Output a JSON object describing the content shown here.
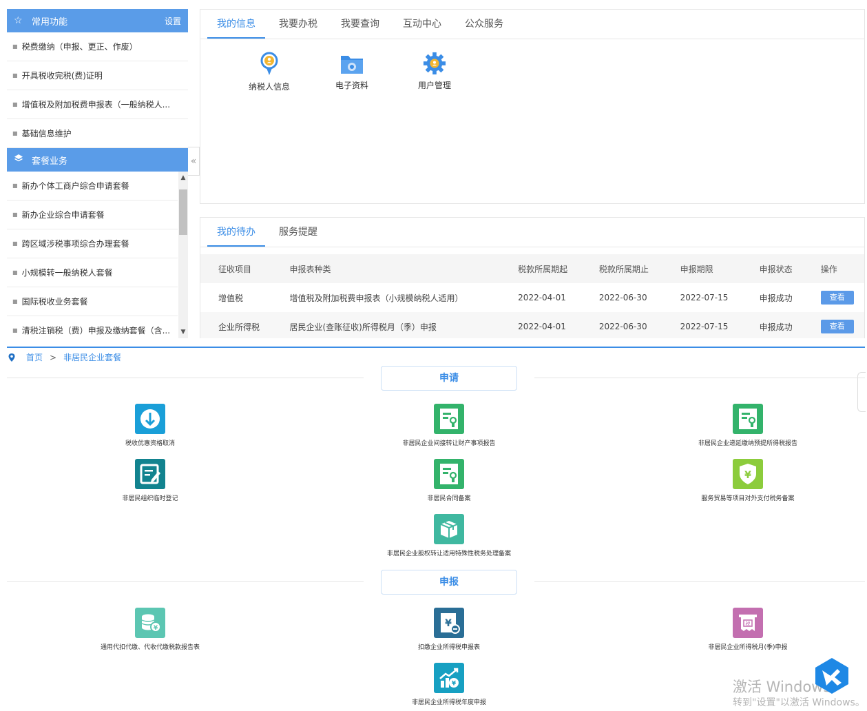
{
  "sidebar": {
    "common": {
      "title": "常用功能",
      "settings_label": "设置"
    },
    "common_items": [
      "税费缴纳（申报、更正、作废）",
      "开具税收完税(费)证明",
      "增值税及附加税费申报表（一般纳税人...",
      "基础信息维护"
    ],
    "packages": {
      "title": "套餐业务"
    },
    "package_items": [
      "新办个体工商户综合申请套餐",
      "新办企业综合申请套餐",
      "跨区域涉税事项综合办理套餐",
      "小规模转一般纳税人套餐",
      "国际税收业务套餐",
      "清税注销税（费）申报及缴纳套餐（含..."
    ],
    "collapse_glyph": "«"
  },
  "info_panel": {
    "tabs": [
      "我的信息",
      "我要办税",
      "我要查询",
      "互动中心",
      "公众服务"
    ],
    "active_tab": 0,
    "quick_icons": [
      {
        "label": "纳税人信息",
        "icon": "taxpayer-info-icon"
      },
      {
        "label": "电子资料",
        "icon": "e-documents-icon"
      },
      {
        "label": "用户管理",
        "icon": "user-management-icon"
      }
    ]
  },
  "todo_panel": {
    "tabs": [
      "我的待办",
      "服务提醒"
    ],
    "active_tab": 0,
    "columns": [
      "征收项目",
      "申报表种类",
      "税款所属期起",
      "税款所属期止",
      "申报期限",
      "申报状态",
      "操作"
    ],
    "rows": [
      [
        "增值税",
        "增值税及附加税费申报表（小规模纳税人适用）",
        "2022-04-01",
        "2022-06-30",
        "2022-07-15",
        "申报成功",
        "查看"
      ],
      [
        "企业所得税",
        "居民企业(查账征收)所得税月（季）申报",
        "2022-04-01",
        "2022-06-30",
        "2022-07-15",
        "申报成功",
        "查看"
      ]
    ]
  },
  "package_page": {
    "breadcrumb": {
      "home": "首页",
      "separator": ">",
      "current": "非居民企业套餐"
    },
    "sections": [
      {
        "title": "申请",
        "services": [
          {
            "label": "税收优惠资格取消",
            "icon": "download-icon",
            "color": "#1a9fd8"
          },
          {
            "label": "非居民企业间接转让财产事项报告",
            "icon": "certificate-icon",
            "color": "#33b36b"
          },
          {
            "label": "非居民企业递延缴纳预提所得税报告",
            "icon": "certificate-icon",
            "color": "#33b36b"
          },
          {
            "label": "非居民组织临时登记",
            "icon": "edit-form-icon",
            "color": "#12838f"
          },
          {
            "label": "非居民合同备案",
            "icon": "certificate-icon",
            "color": "#33b36b"
          },
          {
            "label": "服务贸易等项目对外支付税务备案",
            "icon": "yuan-shield-icon",
            "color": "#8ccc3c"
          },
          {
            "label": "非居民企业股权转让适用特殊性税务处理备案",
            "icon": "box-icon",
            "color": "#3fb8a0"
          }
        ]
      },
      {
        "title": "申报",
        "services": [
          {
            "label": "通用代扣代缴、代收代缴税款报告表",
            "icon": "coins-icon",
            "color": "#5cc6b2"
          },
          {
            "label": "扣缴企业所得税申报表",
            "icon": "yuan-doc-icon",
            "color": "#2a6e96"
          },
          {
            "label": "非居民企业所得税月(季)申报",
            "icon": "tax-ticket-icon",
            "color": "#c36fb0"
          },
          {
            "label": "非居民企业所得税年度申报",
            "icon": "growth-chart-icon",
            "color": "#17a0c2"
          }
        ]
      }
    ]
  },
  "watermark": {
    "line1": "激活 Windows",
    "line2": "转到\"设置\"以激活 Windows。"
  }
}
